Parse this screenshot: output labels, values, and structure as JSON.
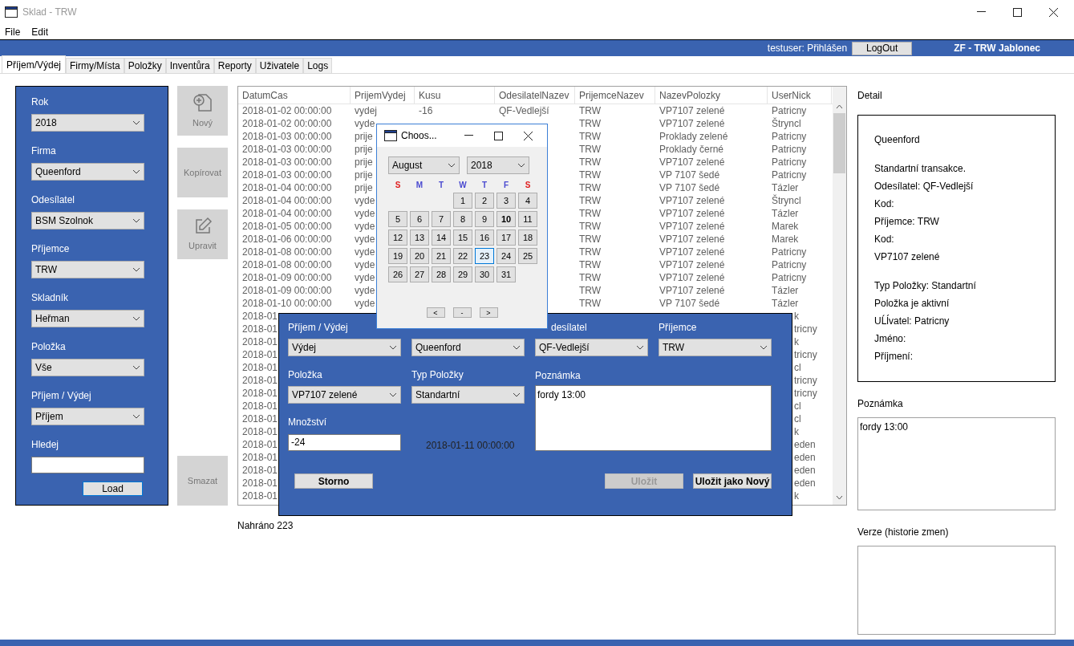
{
  "window": {
    "title": "Sklad - TRW"
  },
  "menu": [
    "File",
    "Edit"
  ],
  "header": {
    "user_status": "testuser: Přihlášen",
    "logout": "LogOut",
    "site": "ZF - TRW Jablonec"
  },
  "tabs": [
    {
      "label": "Příjem/Výdej",
      "selected": true
    },
    {
      "label": "Firmy/Místa",
      "selected": false
    },
    {
      "label": "Položky",
      "selected": false
    },
    {
      "label": "Inventůra",
      "selected": false
    },
    {
      "label": "Reporty",
      "selected": false
    },
    {
      "label": "Uživatele",
      "selected": false
    },
    {
      "label": "Logs",
      "selected": false
    }
  ],
  "filters": {
    "fields": [
      {
        "kind": "select",
        "label": "Rok",
        "value": "2018"
      },
      {
        "kind": "select",
        "label": "Firma",
        "value": "Queenford"
      },
      {
        "kind": "select",
        "label": "Odesílatel",
        "value": "BSM Szolnok"
      },
      {
        "kind": "select",
        "label": "Příjemce",
        "value": "TRW"
      },
      {
        "kind": "select",
        "label": "Skladník",
        "value": "Heřman"
      },
      {
        "kind": "select",
        "label": "Položka",
        "value": "Vše"
      },
      {
        "kind": "select",
        "label": "Příjem / Výdej",
        "value": "Příjem"
      },
      {
        "kind": "text",
        "label": "Hledej"
      }
    ],
    "load_button": "Load"
  },
  "actions": [
    {
      "kind": "new",
      "label": "Nový",
      "disabled": true
    },
    {
      "kind": "copy",
      "label": "Kopírovat",
      "disabled": true
    },
    {
      "kind": "edit",
      "label": "Upravit",
      "disabled": true
    },
    {
      "kind": "delete",
      "label": "Smazat",
      "disabled": true
    }
  ],
  "table": {
    "columns": [
      "DatumCas",
      "PrijemVydej",
      "Kusu",
      "OdesilatelNazev",
      "PrijemceNazev",
      "NazevPolozky",
      "UserNick"
    ],
    "rows": [
      {
        "kind": "full",
        "cells": [
          "2018-01-02 00:00:00",
          "vydej",
          "-16",
          "QF-Vedlejší",
          "TRW",
          "VP7107 zelené",
          "Patricny"
        ]
      },
      {
        "kind": "full",
        "cells": [
          "2018-01-02 00:00:00",
          "vyde",
          null,
          null,
          "TRW",
          "VP7107 zelené",
          "Štryncl"
        ]
      },
      {
        "kind": "full",
        "cells": [
          "2018-01-03 00:00:00",
          "prije",
          null,
          null,
          "TRW",
          "Proklady zelené",
          "Patricny"
        ]
      },
      {
        "kind": "full",
        "cells": [
          "2018-01-03 00:00:00",
          "prije",
          null,
          null,
          "TRW",
          "Proklady černé",
          "Patricny"
        ]
      },
      {
        "kind": "full",
        "cells": [
          "2018-01-03 00:00:00",
          "prije",
          null,
          null,
          "TRW",
          "VP7107 zelené",
          "Patricny"
        ]
      },
      {
        "kind": "full",
        "cells": [
          "2018-01-03 00:00:00",
          "prije",
          null,
          null,
          "TRW",
          "VP 7107 šedé",
          "Patricny"
        ]
      },
      {
        "kind": "full",
        "cells": [
          "2018-01-04 00:00:00",
          "prije",
          null,
          null,
          "TRW",
          "VP 7107 šedé",
          "Tázler"
        ]
      },
      {
        "kind": "full",
        "cells": [
          "2018-01-04 00:00:00",
          "vyde",
          null,
          null,
          "TRW",
          "VP7107 zelené",
          "Štryncl"
        ]
      },
      {
        "kind": "full",
        "cells": [
          "2018-01-04 00:00:00",
          "vyde",
          null,
          null,
          "TRW",
          "VP7107 zelené",
          "Tázler"
        ]
      },
      {
        "kind": "full",
        "cells": [
          "2018-01-05 00:00:00",
          "vyde",
          null,
          null,
          "TRW",
          "VP7107 zelené",
          "Marek"
        ]
      },
      {
        "kind": "full",
        "cells": [
          "2018-01-06 00:00:00",
          "vyde",
          null,
          null,
          "TRW",
          "VP7107 zelené",
          "Marek"
        ]
      },
      {
        "kind": "full",
        "cells": [
          "2018-01-08 00:00:00",
          "vyde",
          null,
          null,
          "TRW",
          "VP7107 zelené",
          "Patricny"
        ]
      },
      {
        "kind": "full",
        "cells": [
          "2018-01-08 00:00:00",
          "vyde",
          null,
          null,
          "TRW",
          "VP7107 zelené",
          "Patricny"
        ]
      },
      {
        "kind": "full",
        "cells": [
          "2018-01-09 00:00:00",
          "vyde",
          null,
          null,
          "TRW",
          "VP7107 zelené",
          "Patricny"
        ]
      },
      {
        "kind": "full",
        "cells": [
          "2018-01-09 00:00:00",
          "vyde",
          null,
          null,
          "TRW",
          "VP7107 zelené",
          "Tázler"
        ]
      },
      {
        "kind": "full",
        "cells": [
          "2018-01-10 00:00:00",
          "vyde",
          null,
          null,
          "TRW",
          "VP 7107 šedé",
          "Tázler"
        ]
      },
      {
        "kind": "partial",
        "cells": [
          "2018-01",
          null,
          null,
          null,
          null,
          null,
          "k"
        ]
      },
      {
        "kind": "partial",
        "cells": [
          "2018-01",
          null,
          null,
          null,
          null,
          null,
          "tricny"
        ]
      },
      {
        "kind": "partial",
        "cells": [
          "2018-01",
          null,
          null,
          null,
          null,
          null,
          "k"
        ]
      },
      {
        "kind": "partial",
        "cells": [
          "2018-01",
          null,
          null,
          null,
          null,
          null,
          "tricny"
        ]
      },
      {
        "kind": "partial",
        "cells": [
          "2018-01",
          null,
          null,
          null,
          null,
          null,
          "cl"
        ]
      },
      {
        "kind": "partial",
        "cells": [
          "2018-01",
          null,
          null,
          null,
          null,
          null,
          "tricny"
        ]
      },
      {
        "kind": "partial",
        "cells": [
          "2018-01",
          null,
          null,
          null,
          null,
          null,
          "tricny"
        ]
      },
      {
        "kind": "partial",
        "cells": [
          "2018-01",
          null,
          null,
          null,
          null,
          null,
          "cl"
        ]
      },
      {
        "kind": "partial",
        "cells": [
          "2018-01",
          null,
          null,
          null,
          null,
          null,
          "cl"
        ]
      },
      {
        "kind": "partial",
        "cells": [
          "2018-01",
          null,
          null,
          null,
          null,
          null,
          "k"
        ]
      },
      {
        "kind": "partial",
        "cells": [
          "2018-01",
          null,
          null,
          null,
          null,
          null,
          "eden"
        ]
      },
      {
        "kind": "partial",
        "cells": [
          "2018-01",
          null,
          null,
          null,
          null,
          null,
          "eden"
        ]
      },
      {
        "kind": "partial",
        "cells": [
          "2018-01",
          null,
          null,
          null,
          null,
          null,
          "eden"
        ]
      },
      {
        "kind": "partial",
        "cells": [
          "2018-01",
          null,
          null,
          null,
          null,
          null,
          "eden"
        ]
      },
      {
        "kind": "partial",
        "cells": [
          "2018-01",
          null,
          null,
          null,
          null,
          null,
          "k"
        ]
      }
    ]
  },
  "status": "Nahráno 223",
  "detail": {
    "title": "Detail",
    "groups": [
      [
        "Queenford"
      ],
      [
        "Standartní transakce.",
        "Odesílatel: QF-Vedlejší",
        "Kod:",
        "Příjemce: TRW",
        "Kod:",
        "VP7107 zelené"
      ],
      [
        "Typ Položky: Standartní",
        "Položka je aktivní",
        "UĹĺvatel: Patricny",
        "Jméno:",
        "Příjmení:"
      ]
    ]
  },
  "note": {
    "label": "Poznámka",
    "value": "fordy 13:00"
  },
  "versions": {
    "label": "Verze (historie zmen)"
  },
  "edit_dialog": {
    "rows": [
      [
        {
          "kind": "select",
          "label": "Příjem / Výdej",
          "value": "Výdej"
        },
        {
          "kind": "select",
          "value": "Queenford"
        },
        {
          "kind": "select",
          "label": "desílatel",
          "value": "QF-Vedlejší"
        },
        {
          "kind": "select",
          "label": "Příjemce",
          "value": "TRW"
        }
      ],
      [
        {
          "kind": "select",
          "label": "Položka",
          "value": "VP7107 zelené"
        },
        {
          "kind": "select",
          "label": "Typ Položky",
          "value": "Standartní"
        }
      ],
      [
        {
          "kind": "text",
          "label": "Množství",
          "value": "-24"
        },
        {
          "kind": "date",
          "value": "2018-01-11 00:00:00"
        }
      ]
    ],
    "note": {
      "label": "Poznámka",
      "value": "fordy 13:00"
    },
    "buttons": [
      {
        "label": "Storno",
        "disabled": false
      },
      {
        "label": "Uložit",
        "disabled": true
      },
      {
        "label": "Uložit jako Nový",
        "disabled": false
      }
    ]
  },
  "calendar": {
    "title": "Choos...",
    "month": "August",
    "year": "2018",
    "weekdays": [
      {
        "label": "S",
        "color": "#e02020"
      },
      {
        "label": "M",
        "color": "#4a4ad0"
      },
      {
        "label": "T",
        "color": "#4a4ad0"
      },
      {
        "label": "W",
        "color": "#4a4ad0"
      },
      {
        "label": "T",
        "color": "#4a4ad0"
      },
      {
        "label": "F",
        "color": "#4a4ad0"
      },
      {
        "label": "S",
        "color": "#e02020"
      }
    ],
    "weeks": [
      {
        "kind": "partial",
        "days": [
          {
            "label": "1",
            "selected": false,
            "bold": false
          },
          {
            "label": "2",
            "selected": false,
            "bold": false
          },
          {
            "label": "3",
            "selected": false,
            "bold": false
          },
          {
            "label": "4",
            "selected": false,
            "bold": false
          }
        ]
      },
      {
        "kind": "full",
        "days": [
          {
            "label": "5",
            "selected": false,
            "bold": false
          },
          {
            "label": "6",
            "selected": false,
            "bold": false
          },
          {
            "label": "7",
            "selected": false,
            "bold": false
          },
          {
            "label": "8",
            "selected": false,
            "bold": false
          },
          {
            "label": "9",
            "selected": false,
            "bold": false
          },
          {
            "label": "10",
            "selected": false,
            "bold": true
          },
          {
            "label": "11",
            "selected": false,
            "bold": false
          }
        ]
      },
      {
        "kind": "full",
        "days": [
          {
            "label": "12",
            "selected": false,
            "bold": false
          },
          {
            "label": "13",
            "selected": false,
            "bold": false
          },
          {
            "label": "14",
            "selected": false,
            "bold": false
          },
          {
            "label": "15",
            "selected": false,
            "bold": false
          },
          {
            "label": "16",
            "selected": false,
            "bold": false
          },
          {
            "label": "17",
            "selected": false,
            "bold": false
          },
          {
            "label": "18",
            "selected": false,
            "bold": false
          }
        ]
      },
      {
        "kind": "full",
        "days": [
          {
            "label": "19",
            "selected": false,
            "bold": false
          },
          {
            "label": "20",
            "selected": false,
            "bold": false
          },
          {
            "label": "21",
            "selected": false,
            "bold": false
          },
          {
            "label": "22",
            "selected": false,
            "bold": false
          },
          {
            "label": "23",
            "selected": true,
            "bold": false
          },
          {
            "label": "24",
            "selected": false,
            "bold": false
          },
          {
            "label": "25",
            "selected": false,
            "bold": false
          }
        ]
      },
      {
        "kind": "full",
        "days": [
          {
            "label": "26",
            "selected": false,
            "bold": false
          },
          {
            "label": "27",
            "selected": false,
            "bold": false
          },
          {
            "label": "28",
            "selected": false,
            "bold": false
          },
          {
            "label": "29",
            "selected": false,
            "bold": false
          },
          {
            "label": "30",
            "selected": false,
            "bold": false
          },
          {
            "label": "31",
            "selected": false,
            "bold": false
          }
        ]
      }
    ],
    "nav": [
      "<",
      "-",
      ">"
    ]
  }
}
